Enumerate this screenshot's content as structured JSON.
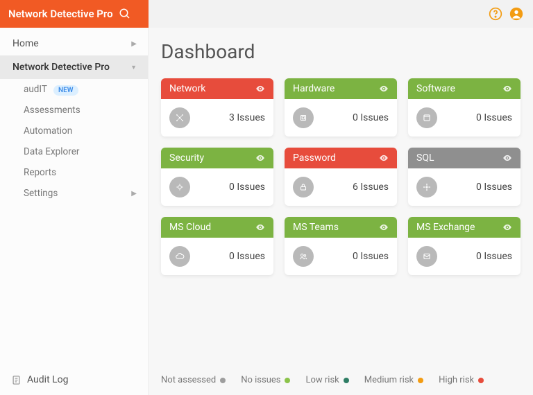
{
  "brand": {
    "title": "Network Detective Pro"
  },
  "sidebar": {
    "items": [
      {
        "label": "Home",
        "chevron": "▶"
      },
      {
        "label": "Network Detective Pro",
        "chevron": "▼"
      }
    ],
    "sub": [
      {
        "label": "audIT",
        "badge": "NEW"
      },
      {
        "label": "Assessments"
      },
      {
        "label": "Automation"
      },
      {
        "label": "Data Explorer"
      },
      {
        "label": "Reports"
      },
      {
        "label": "Settings",
        "chevron": "▶"
      }
    ],
    "audit": "Audit Log"
  },
  "page": {
    "title": "Dashboard"
  },
  "cards": [
    {
      "title": "Network",
      "risk": "high",
      "issues": "3 Issues",
      "icon": "network"
    },
    {
      "title": "Hardware",
      "risk": "none",
      "issues": "0 Issues",
      "icon": "hardware"
    },
    {
      "title": "Software",
      "risk": "none",
      "issues": "0 Issues",
      "icon": "software"
    },
    {
      "title": "Security",
      "risk": "none",
      "issues": "0 Issues",
      "icon": "security"
    },
    {
      "title": "Password",
      "risk": "high",
      "issues": "6 Issues",
      "icon": "password"
    },
    {
      "title": "SQL",
      "risk": "na",
      "issues": "0 Issues",
      "icon": "sql"
    },
    {
      "title": "MS Cloud",
      "risk": "none",
      "issues": "0 Issues",
      "icon": "cloud"
    },
    {
      "title": "MS Teams",
      "risk": "none",
      "issues": "0 Issues",
      "icon": "teams"
    },
    {
      "title": "MS Exchange",
      "risk": "none",
      "issues": "0 Issues",
      "icon": "exchange"
    }
  ],
  "legend": [
    {
      "label": "Not assessed",
      "color": "#9e9e9e"
    },
    {
      "label": "No issues",
      "color": "#8bc34a"
    },
    {
      "label": "Low risk",
      "color": "#2e7d64"
    },
    {
      "label": "Medium risk",
      "color": "#f39c12"
    },
    {
      "label": "High risk",
      "color": "#e74c3c"
    }
  ]
}
